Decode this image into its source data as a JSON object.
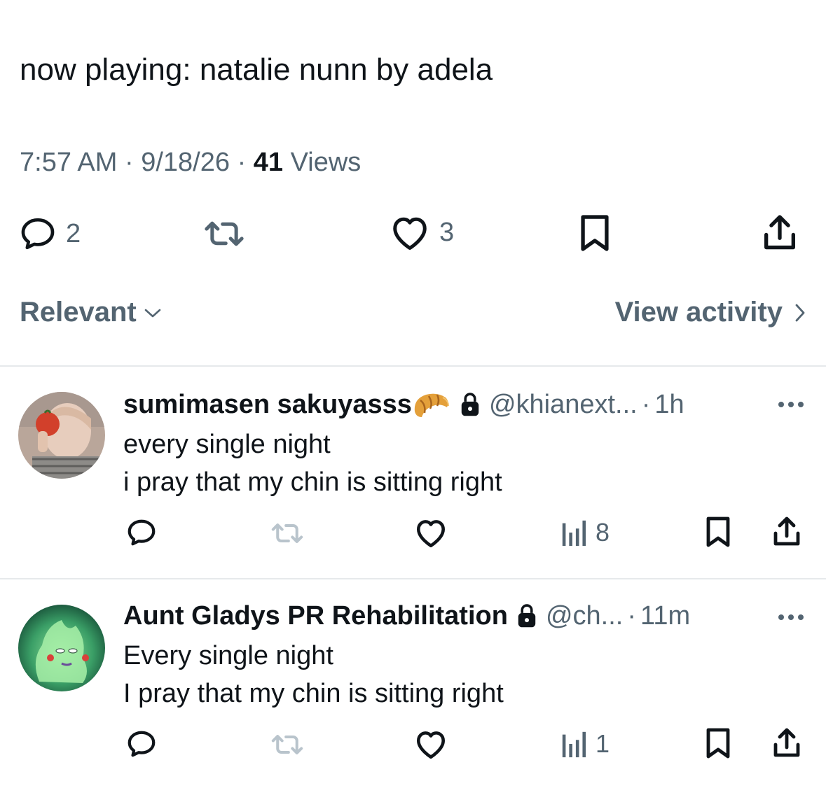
{
  "tweet": {
    "text": "now playing: natalie nunn by adela",
    "time": "7:57 AM",
    "date": "9/18/26",
    "views_count": "41",
    "views_label": "Views",
    "separator": "·",
    "actions": {
      "reply_count": "2",
      "repost_count": "",
      "like_count": "3"
    }
  },
  "sort": {
    "label": "Relevant",
    "view_activity_label": "View activity"
  },
  "replies": [
    {
      "name": "sumimasen sakuyasss",
      "name_emoji": "croissant-emoji",
      "handle": "@khianext...",
      "separator": "·",
      "time": "1h",
      "lines": [
        "every single night",
        "i pray that my chin is sitting right"
      ],
      "views": "8",
      "protected": true
    },
    {
      "name": "Aunt Gladys PR Rehabilitation",
      "handle": "@ch...",
      "separator": "·",
      "time": "11m",
      "lines": [
        "Every single night",
        "I pray that my chin is sitting right"
      ],
      "views": "1",
      "protected": true
    }
  ],
  "colors": {
    "text": "#0f1419",
    "secondary": "#536471",
    "disabled_repost": "#b9c4cc",
    "divider": "#e6e9eb"
  },
  "icons": [
    "reply-icon",
    "repost-icon",
    "like-icon",
    "bookmark-icon",
    "share-icon",
    "chevron-down-icon",
    "chevron-right-icon",
    "lock-icon",
    "analytics-icon",
    "more-icon"
  ]
}
